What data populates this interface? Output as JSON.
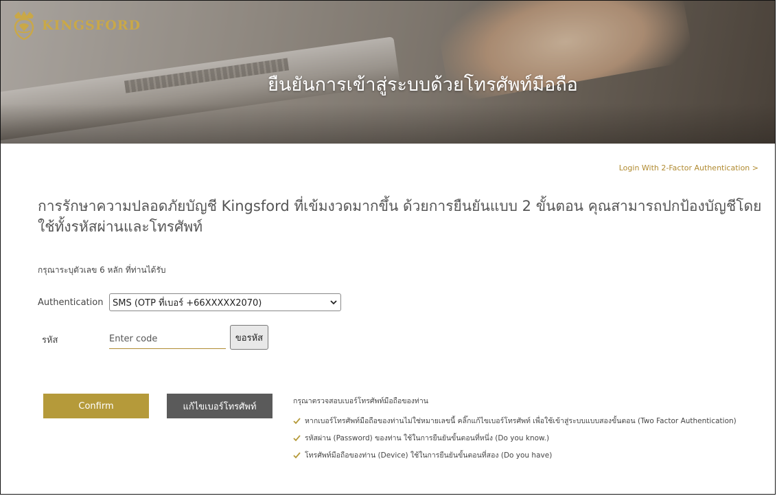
{
  "brand": {
    "name": "KINGSFORD",
    "logo_icon": "lion-crest-icon",
    "accent": "#b59a3a"
  },
  "banner": {
    "title": "ยืนยันการเข้าสู่ระบบด้วยโทรศัพท์มือถือ"
  },
  "login_2fa_link": "Login With 2-Factor Authentication  >",
  "headline": "การรักษาความปลอดภัยบัญชี Kingsford ที่เข้มงวดมากขึ้น ด้วยการยืนยันแบบ 2 ขั้นตอน คุณสามารถปกป้องบัญชีโดยใช้ทั้งรหัสผ่านและโทรศัพท์",
  "hint": "กรุณาระบุตัวเลข 6 หลัก  ที่ท่านได้รับ",
  "form": {
    "auth_label": "Authentication",
    "auth_selected": "SMS (OTP ที่เบอร์ +66XXXXX2070)",
    "code_label": "รหัส",
    "code_placeholder": "Enter code",
    "request_code_button": "ขอรหัส"
  },
  "buttons": {
    "confirm": "Confirm",
    "edit_phone": "แก้ไขเบอร์โทรศัพท์"
  },
  "notes": {
    "title": "กรุณาตรวจสอบเบอร์โทรศัพท์มือถือของท่าน",
    "items": [
      "หากเบอร์โทรศัพท์มือถือของท่านไม่ใช่หมายเลขนี้ คลิ๊กแก้ไขเบอร์โทรศัพท์ เพื่อใช้เข้าสู่ระบบแบบสองขั้นตอน (Two Factor Authentication)",
      "รหัสผ่าน (Password) ของท่าน ใช้ในการยืนยันขั้นตอนที่หนึ่ง (Do you know.)",
      "โทรศัพท์มือถือของท่าน (Device) ใช้ในการยืนยันขั้นตอนที่สอง (Do you have)"
    ],
    "check_icon": "checkmark-icon"
  }
}
